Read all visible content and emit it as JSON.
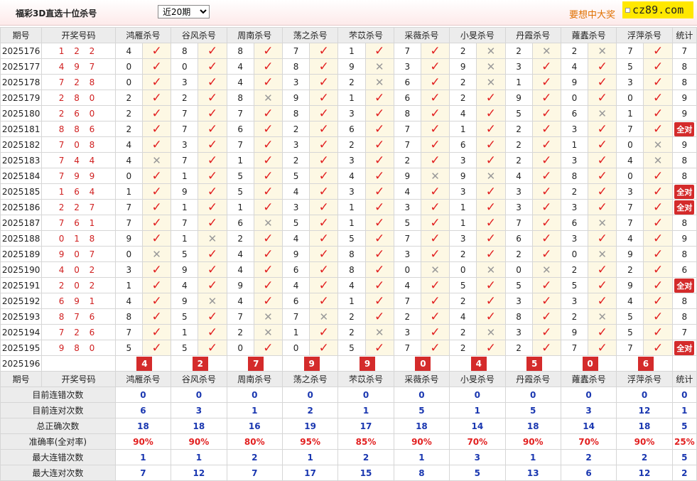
{
  "header": {
    "title": "福彩3D直选十位杀号",
    "period_select": "近20期",
    "promo": "要想中大奖",
    "brand": "cz89.com"
  },
  "columns": {
    "issue": "期号",
    "code": "开奖号码",
    "experts": [
      "鸿雁杀号",
      "谷风杀号",
      "周南杀号",
      "荡之杀号",
      "芣苡杀号",
      "采薇杀号",
      "小旻杀号",
      "丹霞杀号",
      "蕹蠹杀号",
      "浮萍杀号"
    ],
    "total": "统计"
  },
  "rows": [
    {
      "issue": "2025176",
      "code": "1 2 2",
      "kills": [
        [
          "4",
          true
        ],
        [
          "8",
          true
        ],
        [
          "8",
          true
        ],
        [
          "7",
          true
        ],
        [
          "1",
          true
        ],
        [
          "7",
          true
        ],
        [
          "2",
          false
        ],
        [
          "2",
          false
        ],
        [
          "2",
          false
        ],
        [
          "7",
          true
        ]
      ],
      "total": "7"
    },
    {
      "issue": "2025177",
      "code": "4 9 7",
      "kills": [
        [
          "0",
          true
        ],
        [
          "0",
          true
        ],
        [
          "4",
          true
        ],
        [
          "8",
          true
        ],
        [
          "9",
          false
        ],
        [
          "3",
          true
        ],
        [
          "9",
          false
        ],
        [
          "3",
          true
        ],
        [
          "4",
          true
        ],
        [
          "5",
          true
        ]
      ],
      "total": "8"
    },
    {
      "issue": "2025178",
      "code": "7 2 8",
      "kills": [
        [
          "0",
          true
        ],
        [
          "3",
          true
        ],
        [
          "4",
          true
        ],
        [
          "3",
          true
        ],
        [
          "2",
          false
        ],
        [
          "6",
          true
        ],
        [
          "2",
          false
        ],
        [
          "1",
          true
        ],
        [
          "9",
          true
        ],
        [
          "3",
          true
        ]
      ],
      "total": "8"
    },
    {
      "issue": "2025179",
      "code": "2 8 0",
      "kills": [
        [
          "2",
          true
        ],
        [
          "2",
          true
        ],
        [
          "8",
          false
        ],
        [
          "9",
          true
        ],
        [
          "1",
          true
        ],
        [
          "6",
          true
        ],
        [
          "2",
          true
        ],
        [
          "9",
          true
        ],
        [
          "0",
          true
        ],
        [
          "0",
          true
        ]
      ],
      "total": "9"
    },
    {
      "issue": "2025180",
      "code": "2 6 0",
      "kills": [
        [
          "2",
          true
        ],
        [
          "7",
          true
        ],
        [
          "7",
          true
        ],
        [
          "8",
          true
        ],
        [
          "3",
          true
        ],
        [
          "8",
          true
        ],
        [
          "4",
          true
        ],
        [
          "5",
          true
        ],
        [
          "6",
          false
        ],
        [
          "1",
          true
        ]
      ],
      "total": "9"
    },
    {
      "issue": "2025181",
      "code": "8 8 6",
      "kills": [
        [
          "2",
          true
        ],
        [
          "7",
          true
        ],
        [
          "6",
          true
        ],
        [
          "2",
          true
        ],
        [
          "6",
          true
        ],
        [
          "7",
          true
        ],
        [
          "1",
          true
        ],
        [
          "2",
          true
        ],
        [
          "3",
          true
        ],
        [
          "7",
          true
        ]
      ],
      "total": "全对",
      "all": true
    },
    {
      "issue": "2025182",
      "code": "7 0 8",
      "kills": [
        [
          "4",
          true
        ],
        [
          "3",
          true
        ],
        [
          "7",
          true
        ],
        [
          "3",
          true
        ],
        [
          "2",
          true
        ],
        [
          "7",
          true
        ],
        [
          "6",
          true
        ],
        [
          "2",
          true
        ],
        [
          "1",
          true
        ],
        [
          "0",
          false
        ]
      ],
      "total": "9"
    },
    {
      "issue": "2025183",
      "code": "7 4 4",
      "kills": [
        [
          "4",
          false
        ],
        [
          "7",
          true
        ],
        [
          "1",
          true
        ],
        [
          "2",
          true
        ],
        [
          "3",
          true
        ],
        [
          "2",
          true
        ],
        [
          "3",
          true
        ],
        [
          "2",
          true
        ],
        [
          "3",
          true
        ],
        [
          "4",
          false
        ]
      ],
      "total": "8"
    },
    {
      "issue": "2025184",
      "code": "7 9 9",
      "kills": [
        [
          "0",
          true
        ],
        [
          "1",
          true
        ],
        [
          "5",
          true
        ],
        [
          "5",
          true
        ],
        [
          "4",
          true
        ],
        [
          "9",
          false
        ],
        [
          "9",
          false
        ],
        [
          "4",
          true
        ],
        [
          "8",
          true
        ],
        [
          "0",
          true
        ]
      ],
      "total": "8"
    },
    {
      "issue": "2025185",
      "code": "1 6 4",
      "kills": [
        [
          "1",
          true
        ],
        [
          "9",
          true
        ],
        [
          "5",
          true
        ],
        [
          "4",
          true
        ],
        [
          "3",
          true
        ],
        [
          "4",
          true
        ],
        [
          "3",
          true
        ],
        [
          "3",
          true
        ],
        [
          "2",
          true
        ],
        [
          "3",
          true
        ]
      ],
      "total": "全对",
      "all": true
    },
    {
      "issue": "2025186",
      "code": "2 2 7",
      "kills": [
        [
          "7",
          true
        ],
        [
          "1",
          true
        ],
        [
          "1",
          true
        ],
        [
          "3",
          true
        ],
        [
          "1",
          true
        ],
        [
          "3",
          true
        ],
        [
          "1",
          true
        ],
        [
          "3",
          true
        ],
        [
          "3",
          true
        ],
        [
          "7",
          true
        ]
      ],
      "total": "全对",
      "all": true
    },
    {
      "issue": "2025187",
      "code": "7 6 1",
      "kills": [
        [
          "7",
          true
        ],
        [
          "7",
          true
        ],
        [
          "6",
          false
        ],
        [
          "5",
          true
        ],
        [
          "1",
          true
        ],
        [
          "5",
          true
        ],
        [
          "1",
          true
        ],
        [
          "7",
          true
        ],
        [
          "6",
          false
        ],
        [
          "7",
          true
        ]
      ],
      "total": "8"
    },
    {
      "issue": "2025188",
      "code": "0 1 8",
      "kills": [
        [
          "9",
          true
        ],
        [
          "1",
          false
        ],
        [
          "2",
          true
        ],
        [
          "4",
          true
        ],
        [
          "5",
          true
        ],
        [
          "7",
          true
        ],
        [
          "3",
          true
        ],
        [
          "6",
          true
        ],
        [
          "3",
          true
        ],
        [
          "4",
          true
        ]
      ],
      "total": "9"
    },
    {
      "issue": "2025189",
      "code": "9 0 7",
      "kills": [
        [
          "0",
          false
        ],
        [
          "5",
          true
        ],
        [
          "4",
          true
        ],
        [
          "9",
          true
        ],
        [
          "8",
          true
        ],
        [
          "3",
          true
        ],
        [
          "2",
          true
        ],
        [
          "2",
          true
        ],
        [
          "0",
          false
        ],
        [
          "9",
          true
        ]
      ],
      "total": "8"
    },
    {
      "issue": "2025190",
      "code": "4 0 2",
      "kills": [
        [
          "3",
          true
        ],
        [
          "9",
          true
        ],
        [
          "4",
          true
        ],
        [
          "6",
          true
        ],
        [
          "8",
          true
        ],
        [
          "0",
          false
        ],
        [
          "0",
          false
        ],
        [
          "0",
          false
        ],
        [
          "2",
          true
        ],
        [
          "2",
          true
        ]
      ],
      "total": "6"
    },
    {
      "issue": "2025191",
      "code": "2 0 2",
      "kills": [
        [
          "1",
          true
        ],
        [
          "4",
          true
        ],
        [
          "9",
          true
        ],
        [
          "4",
          true
        ],
        [
          "4",
          true
        ],
        [
          "4",
          true
        ],
        [
          "5",
          true
        ],
        [
          "5",
          true
        ],
        [
          "5",
          true
        ],
        [
          "9",
          true
        ]
      ],
      "total": "全对",
      "all": true
    },
    {
      "issue": "2025192",
      "code": "6 9 1",
      "kills": [
        [
          "4",
          true
        ],
        [
          "9",
          false
        ],
        [
          "4",
          true
        ],
        [
          "6",
          true
        ],
        [
          "1",
          true
        ],
        [
          "7",
          true
        ],
        [
          "2",
          true
        ],
        [
          "3",
          true
        ],
        [
          "3",
          true
        ],
        [
          "4",
          true
        ]
      ],
      "total": "8"
    },
    {
      "issue": "2025193",
      "code": "8 7 6",
      "kills": [
        [
          "8",
          true
        ],
        [
          "5",
          true
        ],
        [
          "7",
          false
        ],
        [
          "7",
          false
        ],
        [
          "2",
          true
        ],
        [
          "2",
          true
        ],
        [
          "4",
          true
        ],
        [
          "8",
          true
        ],
        [
          "2",
          false
        ],
        [
          "5",
          true
        ]
      ],
      "total": "8"
    },
    {
      "issue": "2025194",
      "code": "7 2 6",
      "kills": [
        [
          "7",
          true
        ],
        [
          "1",
          true
        ],
        [
          "2",
          false
        ],
        [
          "1",
          true
        ],
        [
          "2",
          false
        ],
        [
          "3",
          true
        ],
        [
          "2",
          false
        ],
        [
          "3",
          true
        ],
        [
          "9",
          true
        ],
        [
          "5",
          true
        ]
      ],
      "total": "7"
    },
    {
      "issue": "2025195",
      "code": "9 8 0",
      "kills": [
        [
          "5",
          true
        ],
        [
          "5",
          true
        ],
        [
          "0",
          true
        ],
        [
          "0",
          true
        ],
        [
          "5",
          true
        ],
        [
          "7",
          true
        ],
        [
          "2",
          true
        ],
        [
          "2",
          true
        ],
        [
          "7",
          true
        ],
        [
          "7",
          true
        ]
      ],
      "total": "全对",
      "all": true
    }
  ],
  "current": {
    "issue": "2025196",
    "label": "当前期杀号",
    "kills": [
      "4",
      "2",
      "7",
      "9",
      "9",
      "0",
      "4",
      "5",
      "0",
      "6"
    ]
  },
  "stats": [
    {
      "label": "目前连错次数",
      "values": [
        "0",
        "0",
        "0",
        "0",
        "0",
        "0",
        "0",
        "0",
        "0",
        "0",
        "0"
      ]
    },
    {
      "label": "目前连对次数",
      "values": [
        "6",
        "3",
        "1",
        "2",
        "1",
        "5",
        "1",
        "5",
        "3",
        "12",
        "1"
      ]
    },
    {
      "label": "总正确次数",
      "values": [
        "18",
        "18",
        "16",
        "19",
        "17",
        "18",
        "14",
        "18",
        "14",
        "18",
        "5"
      ]
    },
    {
      "label": "准确率(全对率)",
      "values": [
        "90%",
        "90%",
        "80%",
        "95%",
        "85%",
        "90%",
        "70%",
        "90%",
        "70%",
        "90%",
        "25%"
      ],
      "accuracy": true
    },
    {
      "label": "最大连错次数",
      "values": [
        "1",
        "1",
        "2",
        "1",
        "2",
        "1",
        "3",
        "1",
        "2",
        "2",
        "5"
      ]
    },
    {
      "label": "最大连对次数",
      "values": [
        "7",
        "12",
        "7",
        "17",
        "15",
        "8",
        "5",
        "13",
        "6",
        "12",
        "2"
      ]
    }
  ],
  "colors": {
    "hit": "#e22020",
    "miss": "#999999",
    "accent": "#d42b2b",
    "stat_value": "#1a37b0",
    "mark_bg": "#fdf8e4"
  }
}
